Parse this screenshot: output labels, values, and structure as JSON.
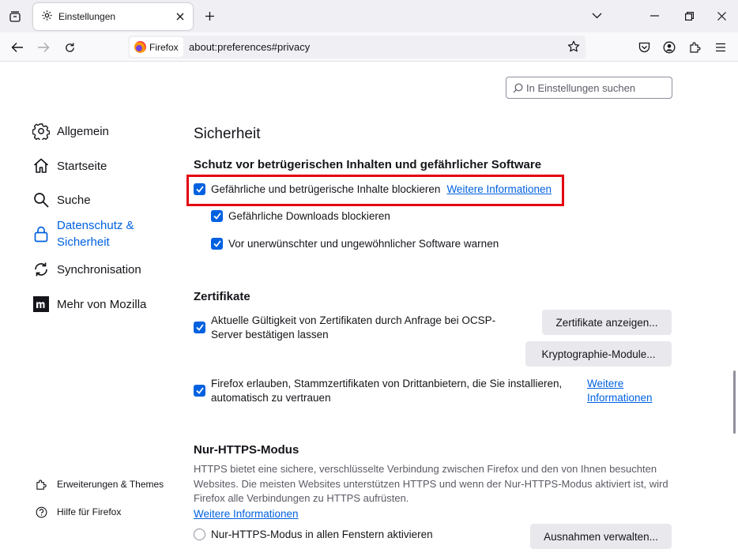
{
  "browser": {
    "tab_title": "Einstellungen",
    "identity_label": "Firefox",
    "url": "about:preferences#privacy"
  },
  "search": {
    "placeholder": "In Einstellungen suchen"
  },
  "sidebar": {
    "items": [
      {
        "label": "Allgemein",
        "icon": "gear-icon"
      },
      {
        "label": "Startseite",
        "icon": "home-icon"
      },
      {
        "label": "Suche",
        "icon": "search-icon"
      },
      {
        "label": "Datenschutz & Sicherheit",
        "line1": "Datenschutz &",
        "line2": "Sicherheit",
        "icon": "lock-icon",
        "selected": true
      },
      {
        "label": "Synchronisation",
        "icon": "sync-icon"
      },
      {
        "label": "Mehr von Mozilla",
        "icon": "mozilla-icon"
      }
    ],
    "footer": [
      {
        "label": "Erweiterungen & Themes",
        "icon": "puzzle-icon"
      },
      {
        "label": "Hilfe für Firefox",
        "icon": "help-icon"
      }
    ]
  },
  "main": {
    "title": "Sicherheit",
    "deceptive": {
      "heading": "Schutz vor betrügerischen Inhalten und gefährlicher Software",
      "block_dangerous": "Gefährliche und betrügerische Inhalte blockieren",
      "more_info": "Weitere Informationen",
      "block_downloads": "Gefährliche Downloads blockieren",
      "warn_unwanted": "Vor unerwünschter und ungewöhnlicher Software warnen"
    },
    "certs": {
      "heading": "Zertifikate",
      "ocsp_line1": "Aktuelle Gültigkeit von Zertifikaten durch Anfrage bei OCSP-",
      "ocsp_line2": "Server bestätigen lassen",
      "view_button": "Zertifikate anzeigen...",
      "crypto_button": "Kryptographie-Module...",
      "thirdparty_line1": "Firefox erlauben, Stammzertifikaten von Drittanbietern, die Sie installieren,",
      "thirdparty_line2": "automatisch zu vertrauen",
      "more_info_line1": "Weitere",
      "more_info_line2": "Informationen"
    },
    "https": {
      "heading": "Nur-HTTPS-Modus",
      "description": "HTTPS bietet eine sichere, verschlüsselte Verbindung zwischen Firefox und den von Ihnen besuchten Websites. Die meisten Websites unterstützen HTTPS und wenn der Nur-HTTPS-Modus aktiviert ist, wird Firefox alle Verbindungen zu HTTPS aufrüsten.",
      "more_info": "Weitere Informationen",
      "all_windows": "Nur-HTTPS-Modus in allen Fenstern aktivieren",
      "exceptions_button": "Ausnahmen verwalten..."
    }
  },
  "colors": {
    "accent": "#0061e0",
    "highlight": "#e3000f"
  }
}
